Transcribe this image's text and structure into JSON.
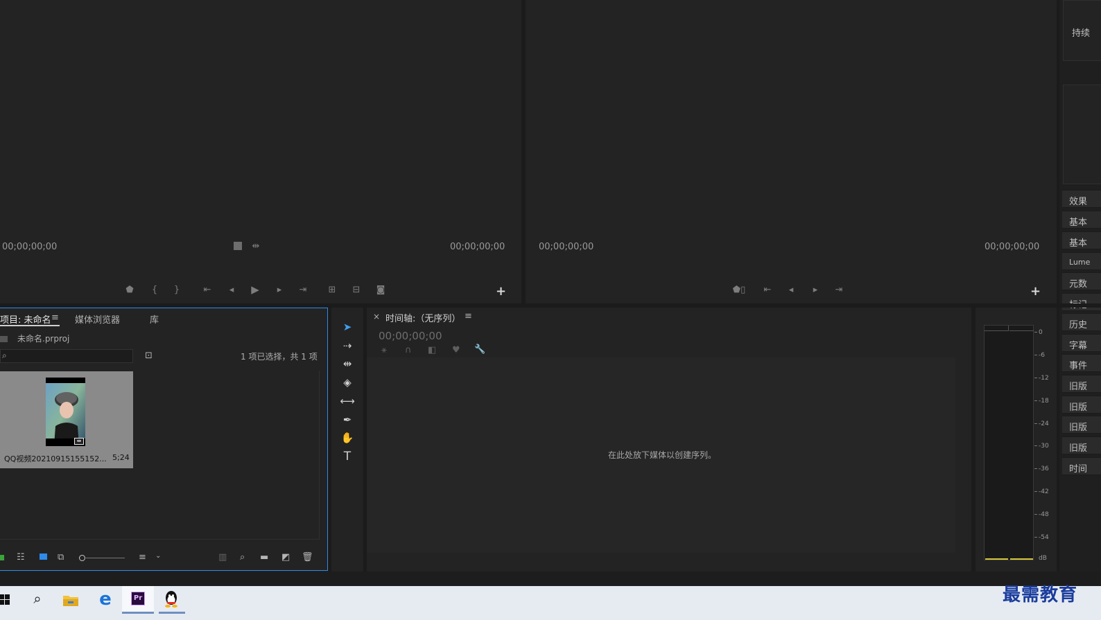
{
  "source_monitor": {
    "timecode_left": "00;00;00;00",
    "timecode_right": "00;00;00;00"
  },
  "program_monitor": {
    "timecode_left": "00;00;00;00",
    "timecode_right": "00;00;00;00"
  },
  "right_panel": {
    "top_label": "持续",
    "tabs": [
      "效果",
      "基本",
      "基本",
      "Lume",
      "元数",
      "标记",
      "历史",
      "字幕",
      "事件",
      "旧版",
      "旧版",
      "旧版",
      "旧版",
      "时间"
    ]
  },
  "project_panel": {
    "tabs": {
      "project": "项目: 未命名",
      "media_browser": "媒体浏览器",
      "library": "库"
    },
    "project_file": "未命名.prproj",
    "selection_status": "1 项已选择，共 1 项",
    "search_placeholder": "",
    "clip": {
      "name": "QQ视频20210915155152...",
      "duration": "5;24"
    }
  },
  "timeline_panel": {
    "tab_label": "时间轴:（无序列）",
    "close_label": "×",
    "timecode": "00;00;00;00",
    "empty_message": "在此处放下媒体以创建序列。"
  },
  "audio_meter": {
    "scale": [
      "0",
      "-6",
      "-12",
      "-18",
      "-24",
      "-30",
      "-36",
      "-42",
      "-48",
      "-54",
      "dB"
    ]
  },
  "taskbar": {
    "apps": [
      "start",
      "search",
      "file-explorer",
      "edge",
      "premiere-pro",
      "qq"
    ],
    "watermark": "最需教育"
  },
  "colors": {
    "panel_bg": "#232323",
    "divider": "#1b1b1b",
    "accent_blue": "#2d8ceb",
    "taskbar_bg": "#e6ebf2",
    "premiere_purple": "#2a0b3d",
    "watermark_blue": "#1a3c9c"
  }
}
